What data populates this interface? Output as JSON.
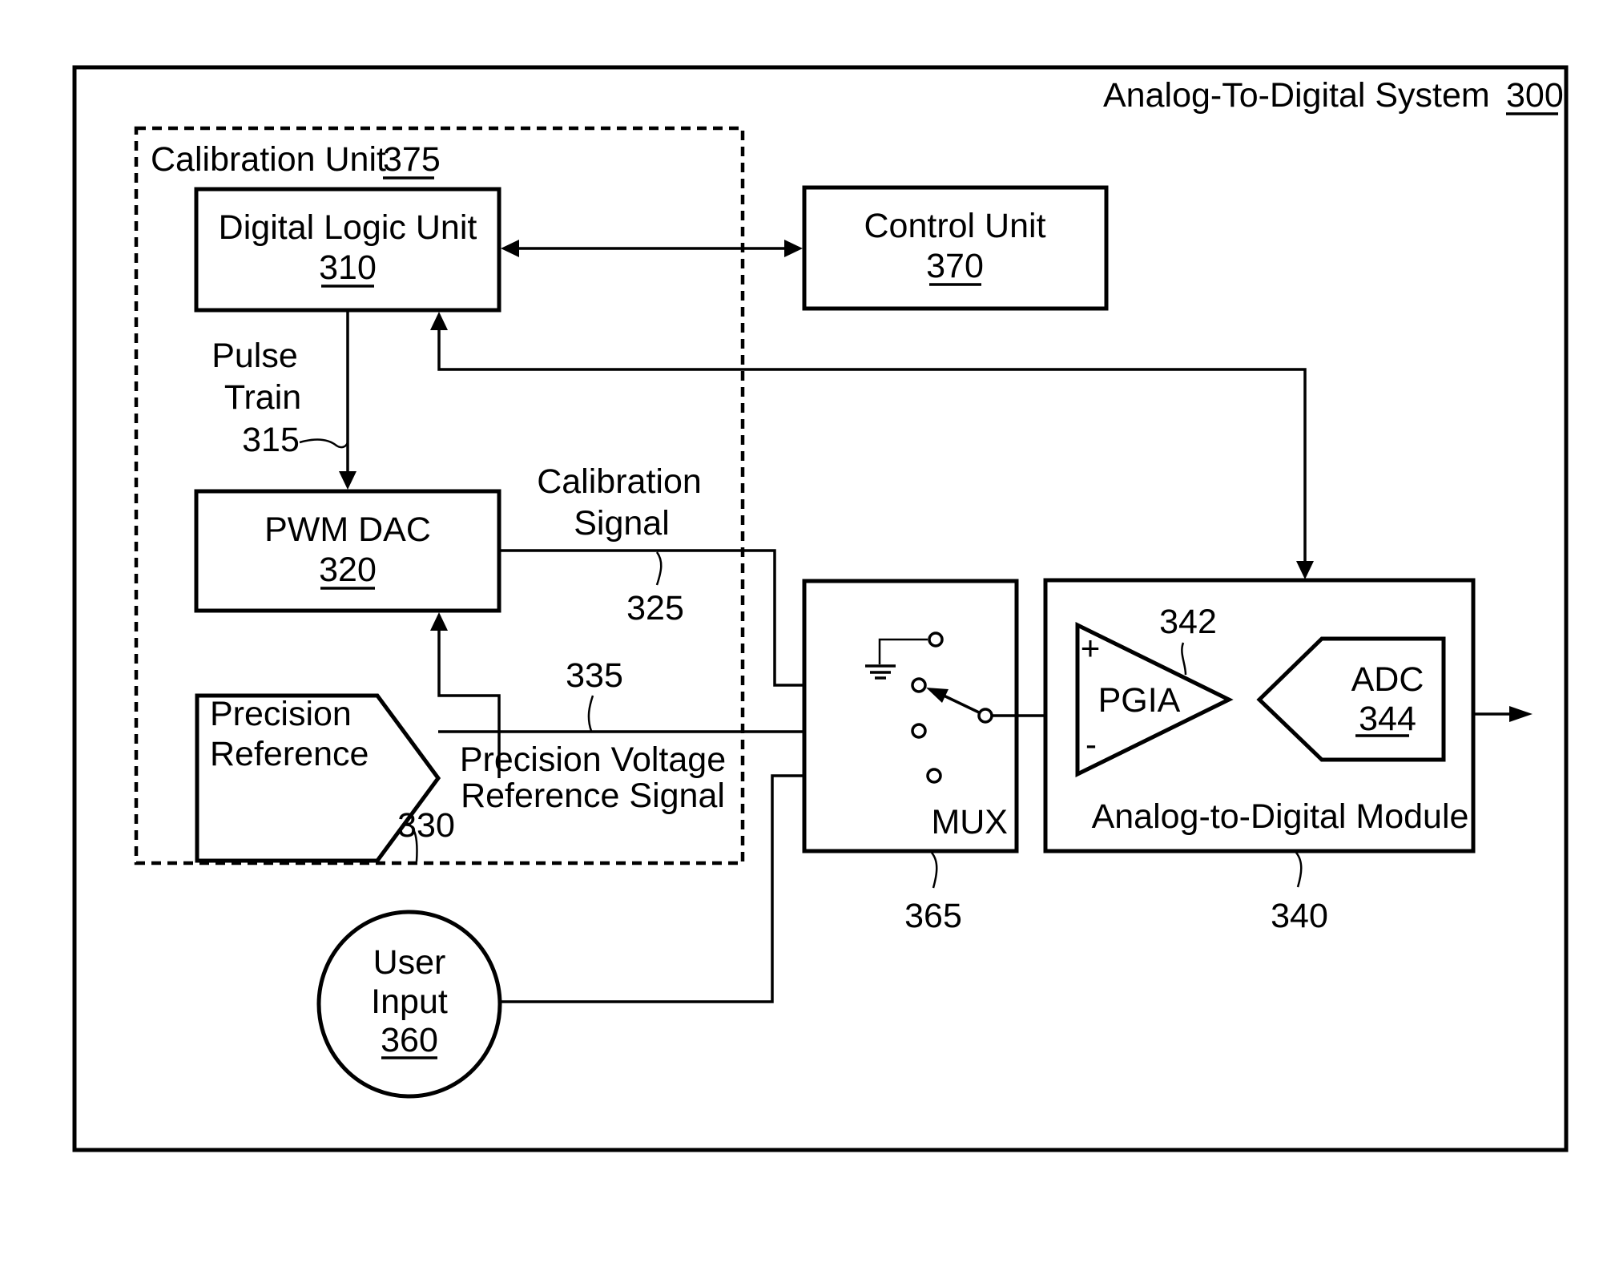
{
  "figure": {
    "system_title": "Analog-To-Digital System",
    "system_ref": "300"
  },
  "calibration_unit": {
    "title": "Calibration Unit",
    "ref": "375"
  },
  "blocks": {
    "digital_logic_unit": {
      "label": "Digital Logic Unit",
      "ref": "310"
    },
    "control_unit": {
      "label": "Control Unit",
      "ref": "370"
    },
    "pwm_dac": {
      "label": "PWM DAC",
      "ref": "320"
    },
    "precision_reference": {
      "line1": "Precision",
      "line2": "Reference",
      "ref": "330"
    },
    "user_input": {
      "line1": "User",
      "line2": "Input",
      "ref": "360"
    },
    "mux": {
      "label": "MUX",
      "ref": "365"
    },
    "adm": {
      "label": "Analog-to-Digital Module",
      "ref": "340"
    },
    "pgia": {
      "label": "PGIA",
      "ref": "342",
      "plus": "+",
      "minus": "-"
    },
    "adc": {
      "label": "ADC",
      "ref": "344"
    }
  },
  "signals": {
    "pulse_train": {
      "line1": "Pulse",
      "line2": "Train",
      "ref": "315"
    },
    "calibration_signal": {
      "line1": "Calibration",
      "line2": "Signal",
      "ref": "325"
    },
    "precision_voltage": {
      "line1": "Precision Voltage",
      "line2": "Reference Signal",
      "ref": "335"
    }
  }
}
